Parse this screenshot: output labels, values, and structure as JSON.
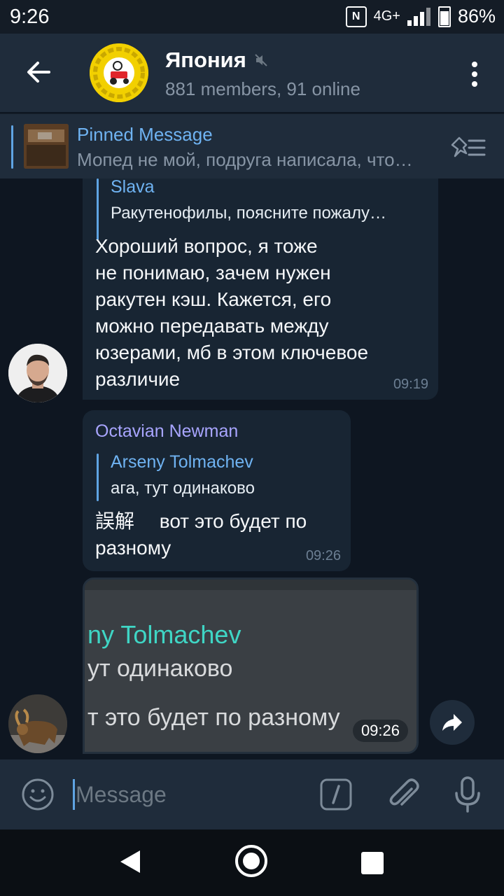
{
  "status_bar": {
    "time": "9:26",
    "network": "4G+",
    "battery": "86%"
  },
  "header": {
    "title": "Япония",
    "subtitle": "881 members, 91 online"
  },
  "pinned": {
    "title": "Pinned Message",
    "text": "Мопед не мой, подруга написала, что…"
  },
  "messages": [
    {
      "reply_name": "Slava",
      "reply_text": "Ракутенофилы, поясните пожалу…",
      "lines": [
        "Хороший вопрос, я тоже",
        "не понимаю, зачем нужен",
        "ракутен кэш. Кажется, его",
        "можно передавать между",
        "юзерами, мб в этом ключевое",
        "различие"
      ],
      "time": "09:19"
    },
    {
      "sender": "Octavian Newman",
      "reply_name": "Arseny Tolmachev",
      "reply_text": "ага, тут одинаково",
      "lines": [
        "誤解　 вот это будет по",
        "разному"
      ],
      "time": "09:26"
    },
    {
      "image_lines": [
        "ny Tolmachev",
        "ут одинаково",
        "т это будет по разному"
      ],
      "time": "09:26"
    }
  ],
  "input": {
    "placeholder": "Message"
  },
  "colors": {
    "accent": "#5fa4e3",
    "bubble": "#182533",
    "background": "#0e1621",
    "header": "#1f2c3b",
    "sender": "#a8a5ff"
  }
}
